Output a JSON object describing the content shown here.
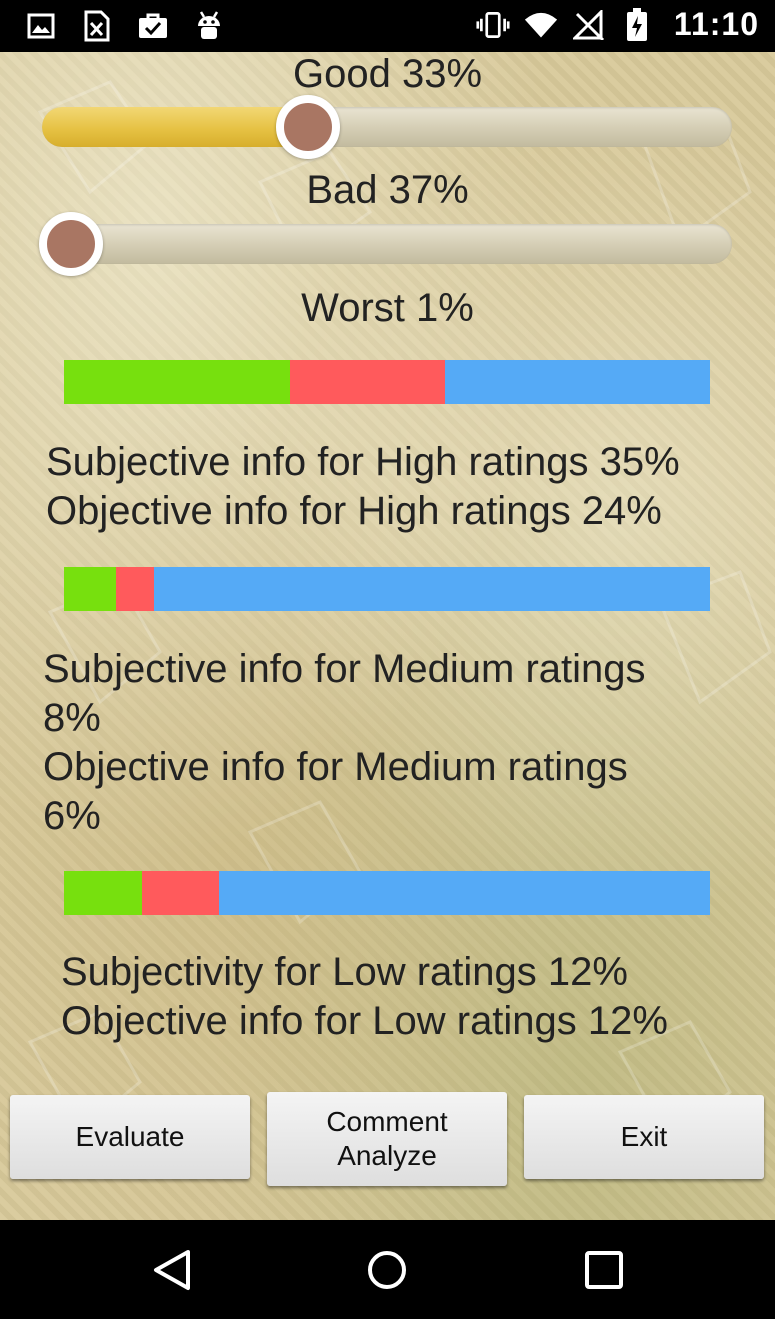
{
  "status_bar": {
    "time": "11:10",
    "left_icons": [
      "image-icon",
      "excel-icon",
      "briefcase-check-icon",
      "android-debug-icon"
    ],
    "right_icons": [
      "vibrate-icon",
      "wifi-icon",
      "no-signal-icon",
      "battery-icon"
    ]
  },
  "sliders": {
    "good": {
      "label": "Good 33%",
      "value": 0.33
    },
    "bad": {
      "label": "Bad 37%",
      "value": 0.0
    },
    "worst": {
      "label": "Worst 1%"
    }
  },
  "colors": {
    "subjective": "#77e00e",
    "objective": "#ff5a5c",
    "remainder": "#55aaf6",
    "slider_fill": "#e6c244",
    "thumb": "#a97663"
  },
  "sections": {
    "high": {
      "subjective_pct": 35,
      "objective_pct": 24,
      "line1": "Subjective info for High ratings 35%",
      "line2": "Objective info for High ratings 24%"
    },
    "medium": {
      "subjective_pct": 8,
      "objective_pct": 6,
      "line1": "Subjective info for Medium ratings",
      "line1b": "8%",
      "line2": "Objective info for Medium ratings",
      "line2b": "6%"
    },
    "low": {
      "subjective_pct": 12,
      "objective_pct": 12,
      "line1": "Subjectivity for Low ratings 12%",
      "line2": "Objective info for Low ratings 12%"
    }
  },
  "buttons": {
    "evaluate": "Evaluate",
    "comment_line1": "Comment",
    "comment_line2": "Analyze",
    "exit": "Exit"
  }
}
